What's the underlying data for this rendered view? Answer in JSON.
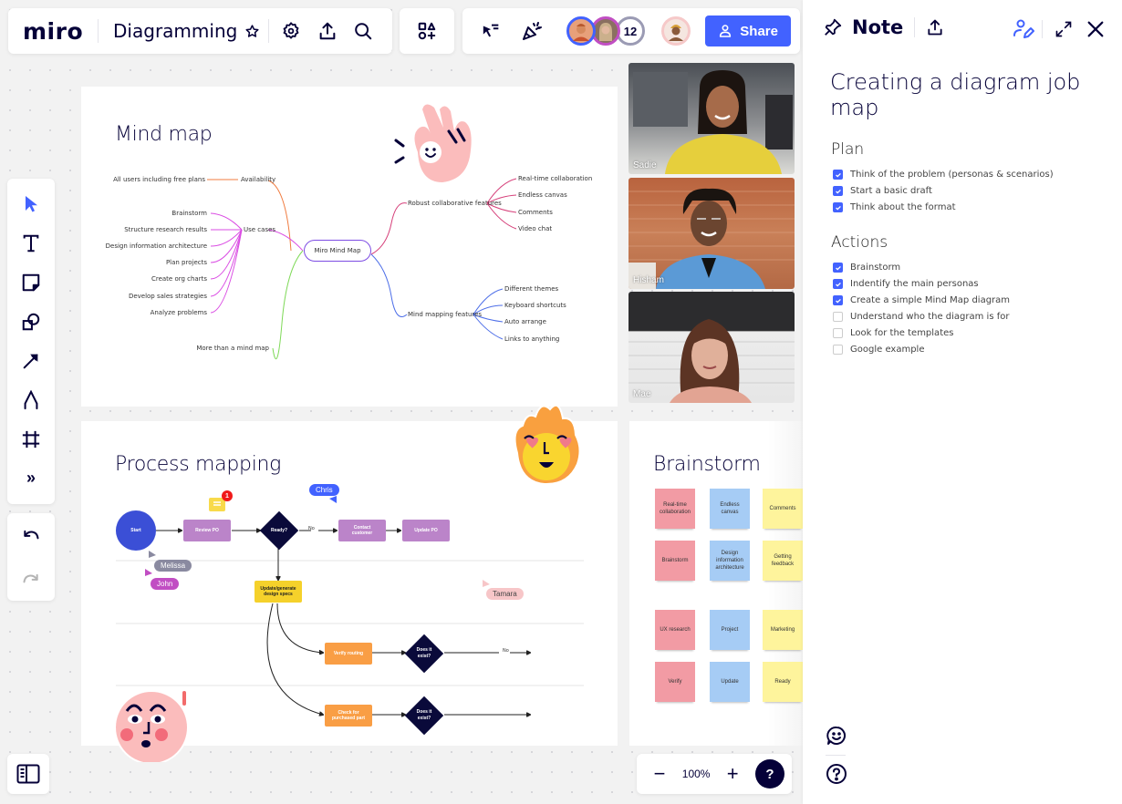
{
  "topbar": {
    "logo": "miro",
    "board_title": "Diagramming",
    "collaborators_count": "12",
    "share_label": "Share",
    "avatar_colors": [
      "#4262ff",
      "#c14ec3",
      "#9b9bb4"
    ],
    "icons": [
      "star-icon",
      "gear-icon",
      "upload-icon",
      "search-icon",
      "apps-icon",
      "reactions-cursor-icon",
      "celebrate-icon",
      "user-icon"
    ]
  },
  "toolbar": {
    "tools": [
      "select-icon",
      "text-icon",
      "sticky-note-icon",
      "shapes-icon",
      "arrow-icon",
      "pen-icon",
      "frame-icon",
      "more-icon"
    ],
    "more_label": "»"
  },
  "zoom": {
    "minus": "−",
    "level": "100%",
    "plus": "+",
    "help": "?"
  },
  "mind_map": {
    "title": "Mind map",
    "center": "Miro Mind Map",
    "branches": [
      {
        "label": "Availability",
        "color": "#f07b3f",
        "children": [
          "All users including free plans"
        ]
      },
      {
        "label": "Use cases",
        "color": "#da4ce3",
        "children": [
          "Brainstorm",
          "Structure research results",
          "Design information architecture",
          "Plan projects",
          "Create org charts",
          "Develop sales strategies",
          "Analyze problems"
        ]
      },
      {
        "label": "More than a mind map",
        "color": "#7ed957",
        "children": []
      },
      {
        "label": "Robust collaborative features",
        "color": "#d6407a",
        "children": [
          "Real-time collaboration",
          "Endless canvas",
          "Comments",
          "Video chat"
        ]
      },
      {
        "label": "Mind mapping features",
        "color": "#4d6ee8",
        "children": [
          "Different themes",
          "Keyboard shortcuts",
          "Auto arrange",
          "Links to anything"
        ]
      }
    ]
  },
  "process_map": {
    "title": "Process mapping",
    "nodes": {
      "start": "Start",
      "review": "Review PO",
      "ready": "Ready?",
      "no": "No",
      "contact": "Contact customer",
      "update_po": "Update PO",
      "update_specs": "Update/generate design specs",
      "verify": "Verify routing",
      "exists1": "Does it exist?",
      "no2": "No",
      "check": "Check for purchased part",
      "exists2": "Does it exist?"
    },
    "comment_badge": "1",
    "cursors": [
      {
        "name": "Chris",
        "color": "#4262ff"
      },
      {
        "name": "Melissa",
        "color": "#8a8aa0"
      },
      {
        "name": "John",
        "color": "#c14ec3"
      },
      {
        "name": "Tamara",
        "color": "#f7c6c8"
      }
    ]
  },
  "brainstorm": {
    "title": "Brainstorm",
    "stickies": [
      {
        "text": "Real-time collaboration",
        "color": "#f29ba4"
      },
      {
        "text": "Endless canvas",
        "color": "#a6ccf5"
      },
      {
        "text": "Comments",
        "color": "#fef49c"
      },
      {
        "text": "Brainstorm",
        "color": "#f29ba4"
      },
      {
        "text": "Design information architecture",
        "color": "#a6ccf5"
      },
      {
        "text": "Getting feedback",
        "color": "#fef49c"
      },
      {
        "text": "UX research",
        "color": "#f29ba4"
      },
      {
        "text": "Project",
        "color": "#a6ccf5"
      },
      {
        "text": "Marketing",
        "color": "#fef49c"
      },
      {
        "text": "Verify",
        "color": "#f29ba4"
      },
      {
        "text": "Update",
        "color": "#a6ccf5"
      },
      {
        "text": "Ready",
        "color": "#fef49c"
      }
    ]
  },
  "video_call": {
    "participants": [
      "Sadie",
      "Hisham",
      "Mae"
    ]
  },
  "note": {
    "header": "Note",
    "title": "Creating a diagram job map",
    "sections": [
      {
        "heading": "Plan",
        "items": [
          {
            "text": "Think of the problem (personas & scenarios)",
            "checked": true
          },
          {
            "text": "Start a basic draft",
            "checked": true
          },
          {
            "text": "Think about the format",
            "checked": true
          }
        ]
      },
      {
        "heading": "Actions",
        "items": [
          {
            "text": "Brainstorm",
            "checked": true
          },
          {
            "text": "Indentify the main personas",
            "checked": true
          },
          {
            "text": "Create a simple Mind Map diagram",
            "checked": true
          },
          {
            "text": "Understand who the diagram is for",
            "checked": false
          },
          {
            "text": "Look for the templates",
            "checked": false
          },
          {
            "text": "Google example",
            "checked": false
          }
        ]
      }
    ]
  }
}
